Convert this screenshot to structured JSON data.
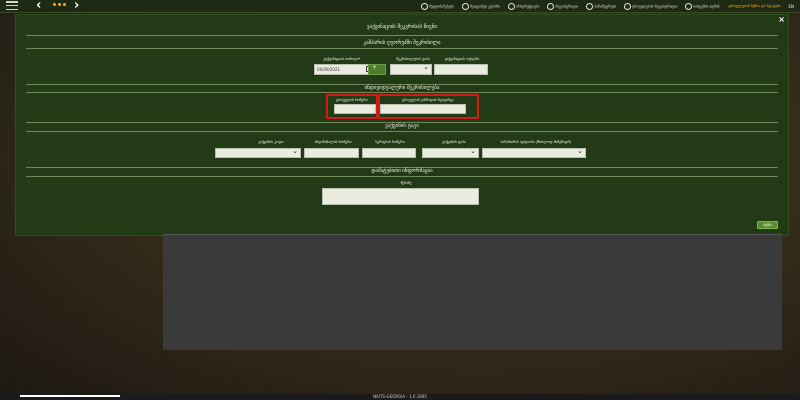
{
  "topbar": {
    "nav_links": [
      {
        "label": "შეტყობინებები",
        "icon": "bell-icon"
      },
      {
        "label": "შეიყვანეთ კუპონი",
        "icon": "ticket-icon"
      },
      {
        "label": "ინსტრუქციები",
        "icon": "book-icon"
      },
      {
        "label": "რეგისტრაცია",
        "icon": "user-icon"
      },
      {
        "label": "პარამეტრები",
        "icon": "gear-icon"
      },
      {
        "label": "ცხოველების რეგისტრაცია",
        "icon": "paw-icon"
      },
      {
        "label": "სისტემის ადმინ.",
        "icon": "admin-icon"
      }
    ],
    "active_link": "ცხოველების ნუსხა და სტატუსი",
    "language": "EN"
  },
  "modal": {
    "title": "ვაქცინაციის შეკვრისას წიგნი",
    "section_request": "კაშპარის ღეორუპში შეკრისილა",
    "request_date_label": "ვაქცინაციის თარიღი*",
    "request_date_value": "06/09/2021",
    "request_type_label": "შეკრისილების ტიპი",
    "request_number_label": "ვაქცინაციის ოქიტრი",
    "section_individual": "ინდივიდუალური შეკრისილება",
    "animal_id_label": "ცხოველის ნომერი",
    "owner_id_label": "ცხოველის ღრმადის რეიტინგი",
    "section_vaccination": "ვაქცინის ტაგი",
    "vaccine_label": "ვაქცინის კოდი",
    "vaccine_serial_label": "ინდიწინალის ნომერი",
    "vaccine_doses_label": "სერიების ნომერი",
    "vaccine_type_label": "ვაქცინის ტიპი",
    "vaccine_disease_label": "საწინაიწის ავადობა (მხოლოდ მიმუშავის)",
    "section_additional": "დამატებითი ინფორმაცია",
    "comment_label": "შენიშვ",
    "search_button": "ძებნა"
  },
  "footer": {
    "version": "NAITS-GEORGIA - 1.0.1695"
  }
}
